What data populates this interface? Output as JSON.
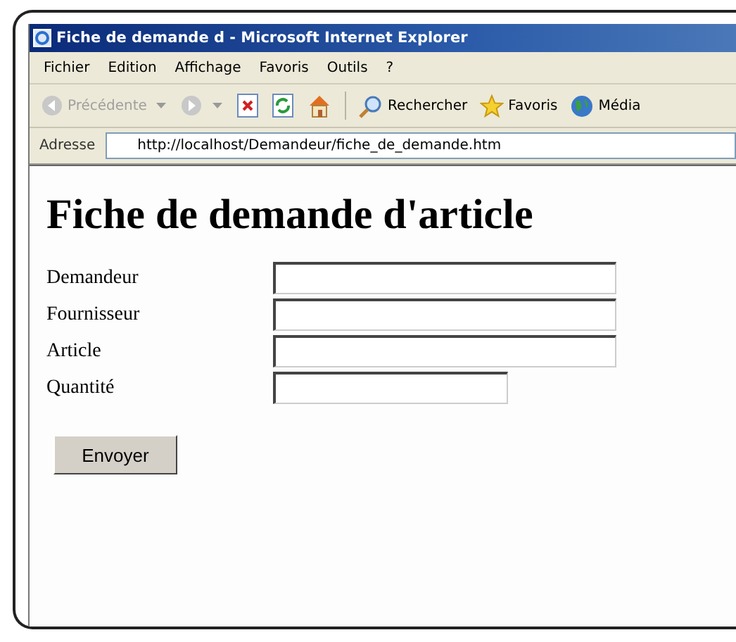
{
  "window": {
    "title": "Fiche de demande d - Microsoft Internet Explorer"
  },
  "menu": [
    "Fichier",
    "Edition",
    "Affichage",
    "Favoris",
    "Outils",
    "?"
  ],
  "toolbar": [
    {
      "kind": "back",
      "label": "Précédente",
      "disabled": true
    },
    {
      "kind": "forward",
      "disabled": true
    },
    {
      "kind": "stop"
    },
    {
      "kind": "refresh"
    },
    {
      "kind": "home"
    },
    {
      "kind": "search",
      "label": "Rechercher"
    },
    {
      "kind": "favorites",
      "label": "Favoris"
    },
    {
      "kind": "media",
      "label": "Média"
    }
  ],
  "address": {
    "label": "Adresse",
    "value": "http://localhost/Demandeur/fiche_de_demande.htm"
  },
  "page": {
    "heading": "Fiche de demande d'article",
    "fields": [
      {
        "label": "Demandeur",
        "kind": "wide"
      },
      {
        "label": "Fournisseur",
        "kind": "wide"
      },
      {
        "label": "Article",
        "kind": "wide"
      },
      {
        "label": "Quantité",
        "kind": "narrow"
      }
    ],
    "submit": "Envoyer"
  }
}
